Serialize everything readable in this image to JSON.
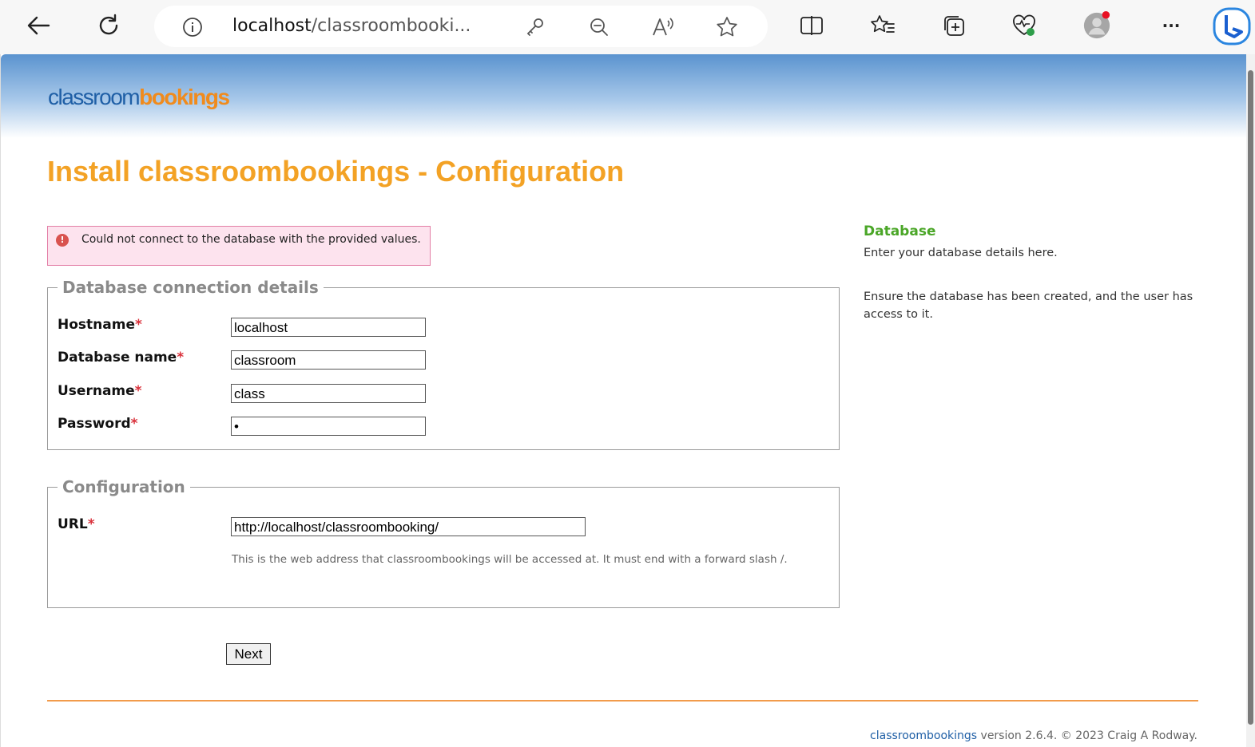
{
  "browser": {
    "address_host": "localhost",
    "address_path": "/classroombooki...",
    "more_label": "···"
  },
  "logo": {
    "part1": "classroom",
    "part2": "bookings"
  },
  "page_title": "Install classroombookings - Configuration",
  "error_message": "Could not connect to the database with the provided values.",
  "db_section": {
    "legend": "Database connection details",
    "fields": [
      {
        "label": "Hostname",
        "value": "localhost"
      },
      {
        "label": "Database name",
        "value": "classroom"
      },
      {
        "label": "Username",
        "value": "class"
      },
      {
        "label": "Password",
        "value": "•"
      }
    ]
  },
  "config_section": {
    "legend": "Configuration",
    "url_label": "URL",
    "url_value": "http://localhost/classroombooking/",
    "help": "This is the web address that classroombookings will be accessed at. It must end with a forward slash /."
  },
  "required_marker": "*",
  "next_label": "Next",
  "sidebar": {
    "title": "Database",
    "line1": "Enter your database details here.",
    "line2": "Ensure the database has been created, and the user has access to it."
  },
  "footer": {
    "brand": "classroombookings",
    "rest": " version 2.6.4. © 2023 Craig A Rodway."
  },
  "colors": {
    "accent_orange": "#f3a225",
    "brand_blue": "#1f5fa6",
    "success_green": "#4aa627",
    "error_pink": "#fde3ee"
  }
}
